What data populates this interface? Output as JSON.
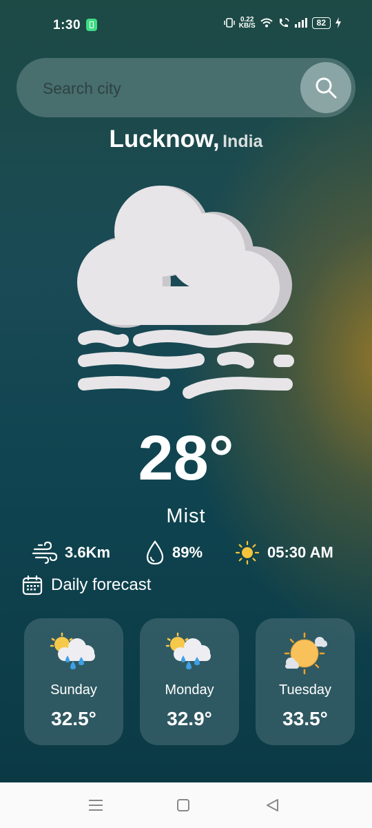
{
  "status_bar": {
    "time": "1:30",
    "net_speed_value": "0.22",
    "net_speed_unit": "KB/S",
    "battery_level": "82"
  },
  "search": {
    "placeholder": "Search city"
  },
  "location": {
    "city": "Lucknow,",
    "country": "India"
  },
  "current": {
    "icon": "mist-cloud-icon",
    "temperature": "28°",
    "condition": "Mist"
  },
  "stats": {
    "wind": "3.6Km",
    "humidity": "89%",
    "sunrise": "05:30 AM"
  },
  "daily_forecast_label": "Daily forecast",
  "forecast": [
    {
      "day": "Sunday",
      "temp": "32.5°",
      "icon": "sun-cloud-rain-icon"
    },
    {
      "day": "Monday",
      "temp": "32.9°",
      "icon": "sun-cloud-rain-icon"
    },
    {
      "day": "Tuesday",
      "temp": "33.5°",
      "icon": "sun-clouds-icon"
    }
  ],
  "colors": {
    "background_dark": "#0f3d48",
    "background_glow": "#96782a",
    "card_bg": "#5a7d82",
    "cloud": "#e6e4e6"
  }
}
